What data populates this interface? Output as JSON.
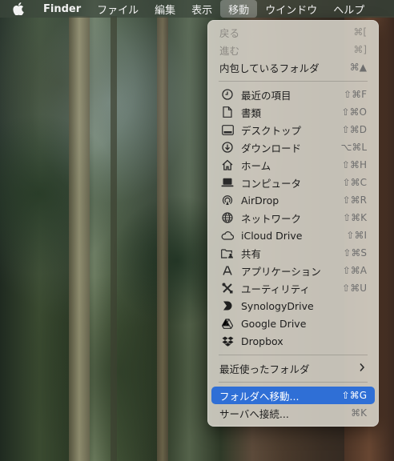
{
  "menubar": {
    "items": [
      "Finder",
      "ファイル",
      "編集",
      "表示",
      "移動",
      "ウインドウ",
      "ヘルプ"
    ]
  },
  "menu": {
    "back": {
      "label": "戻る",
      "shortcut": "⌘["
    },
    "forward": {
      "label": "進む",
      "shortcut": "⌘]"
    },
    "enclosing": {
      "label": "内包しているフォルダ",
      "shortcut": "⌘▲"
    },
    "items": [
      {
        "label": "最近の項目",
        "shortcut": "⇧⌘F",
        "icon": "clock-icon"
      },
      {
        "label": "書類",
        "shortcut": "⇧⌘O",
        "icon": "document-icon"
      },
      {
        "label": "デスクトップ",
        "shortcut": "⇧⌘D",
        "icon": "desktop-icon"
      },
      {
        "label": "ダウンロード",
        "shortcut": "⌥⌘L",
        "icon": "download-icon"
      },
      {
        "label": "ホーム",
        "shortcut": "⇧⌘H",
        "icon": "home-icon"
      },
      {
        "label": "コンピュータ",
        "shortcut": "⇧⌘C",
        "icon": "laptop-icon"
      },
      {
        "label": "AirDrop",
        "shortcut": "⇧⌘R",
        "icon": "airdrop-icon"
      },
      {
        "label": "ネットワーク",
        "shortcut": "⇧⌘K",
        "icon": "network-globe-icon"
      },
      {
        "label": "iCloud Drive",
        "shortcut": "⇧⌘I",
        "icon": "cloud-icon"
      },
      {
        "label": "共有",
        "shortcut": "⇧⌘S",
        "icon": "shared-folder-icon"
      },
      {
        "label": "アプリケーション",
        "shortcut": "⇧⌘A",
        "icon": "applications-icon"
      },
      {
        "label": "ユーティリティ",
        "shortcut": "⇧⌘U",
        "icon": "utilities-icon"
      },
      {
        "label": "SynologyDrive",
        "shortcut": "",
        "icon": "synology-drive-icon"
      },
      {
        "label": "Google Drive",
        "shortcut": "",
        "icon": "google-drive-icon"
      },
      {
        "label": "Dropbox",
        "shortcut": "",
        "icon": "dropbox-icon"
      }
    ],
    "recent_folders": {
      "label": "最近使ったフォルダ"
    },
    "go_to_folder": {
      "label": "フォルダへ移動...",
      "shortcut": "⇧⌘G"
    },
    "connect_server": {
      "label": "サーバへ接続...",
      "shortcut": "⌘K"
    }
  },
  "colors": {
    "selection": "#2f6fd6"
  }
}
